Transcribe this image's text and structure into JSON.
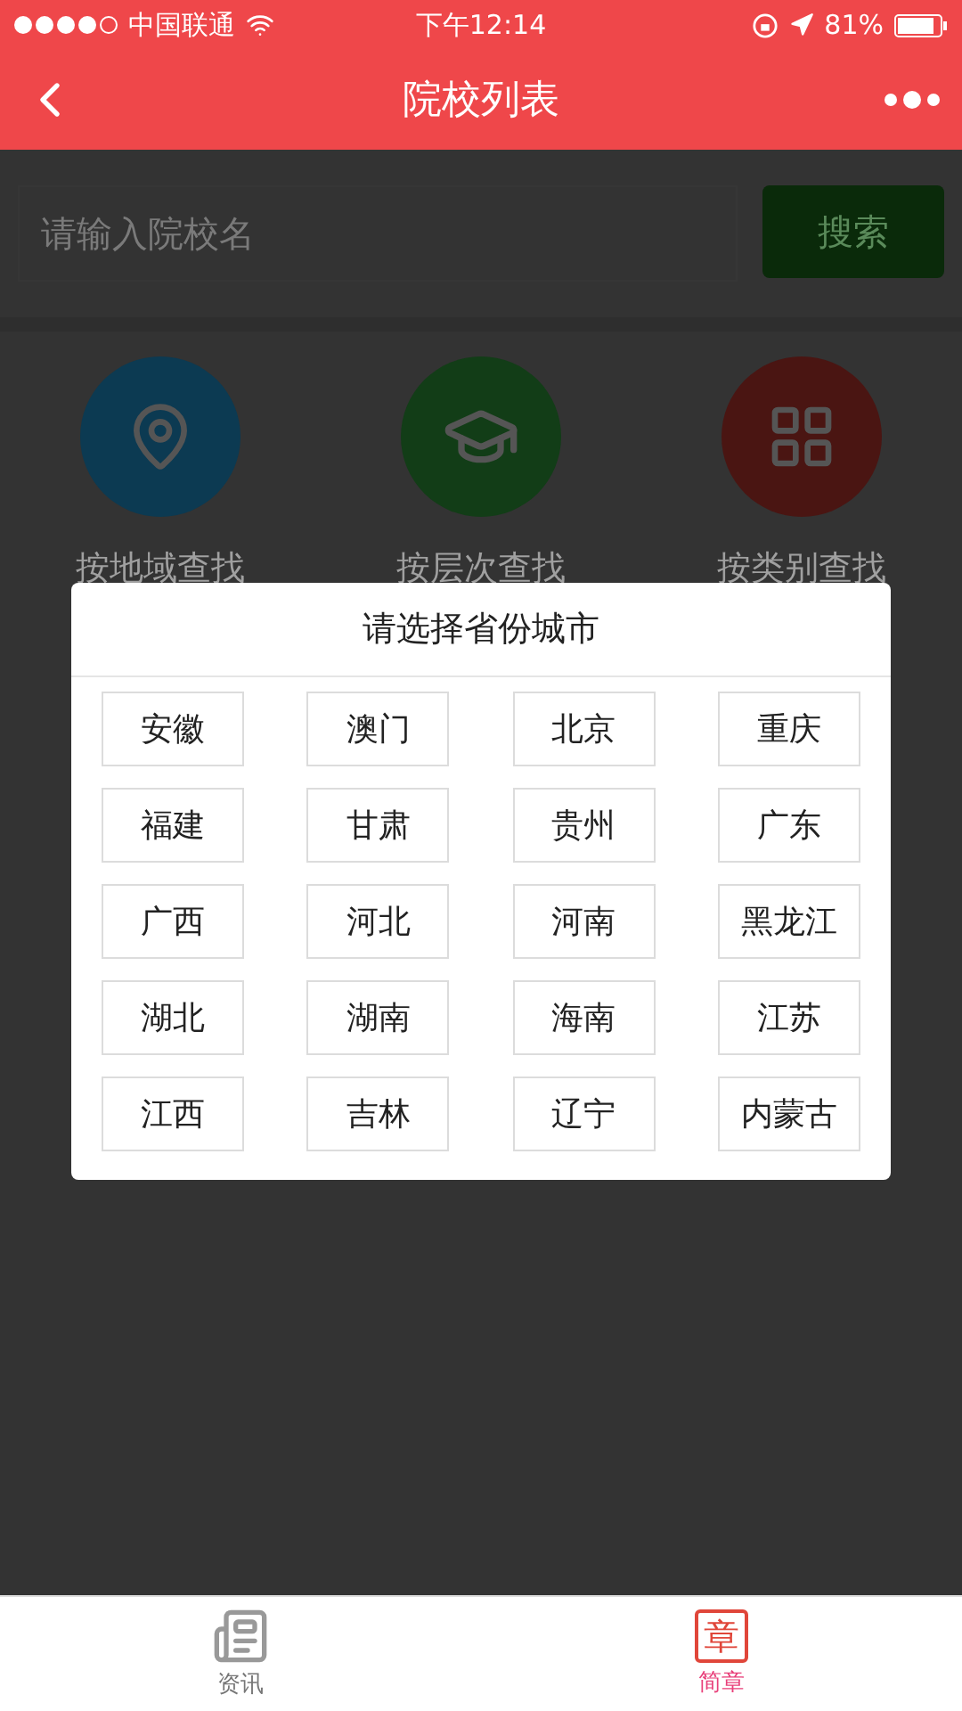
{
  "status_bar": {
    "carrier": "中国联通",
    "time": "下午12:14",
    "battery": "81%"
  },
  "nav": {
    "title": "院校列表"
  },
  "search": {
    "placeholder": "请输入院校名",
    "button": "搜索"
  },
  "categories": [
    {
      "label": "按地域查找",
      "kind": "region",
      "color": "#0c3a52"
    },
    {
      "label": "按层次查找",
      "kind": "level",
      "color": "#123d17"
    },
    {
      "label": "按类别查找",
      "kind": "type",
      "color": "#4a1512"
    }
  ],
  "modal": {
    "title": "请选择省份城市",
    "options": [
      "安徽",
      "澳门",
      "北京",
      "重庆",
      "福建",
      "甘肃",
      "贵州",
      "广东",
      "广西",
      "河北",
      "河南",
      "黑龙江",
      "湖北",
      "湖南",
      "海南",
      "江苏",
      "江西",
      "吉林",
      "辽宁",
      "内蒙古"
    ]
  },
  "tab_bar": [
    {
      "label": "资讯",
      "kind": "news",
      "selected": false
    },
    {
      "label": "简章",
      "kind": "brochure",
      "icon_text": "章",
      "selected": true
    }
  ]
}
